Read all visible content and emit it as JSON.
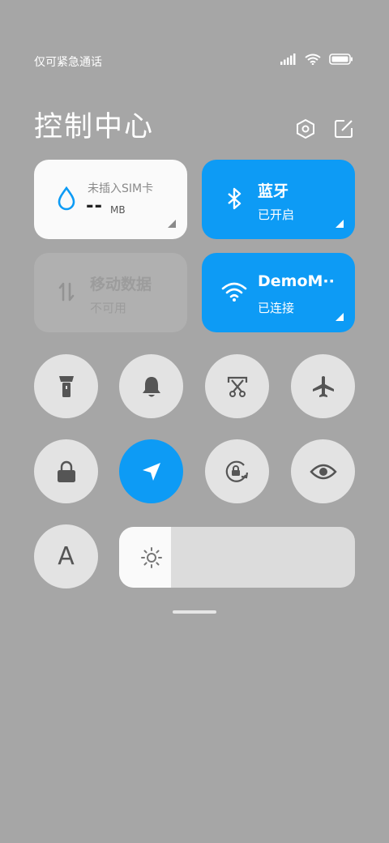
{
  "status_bar": {
    "carrier": "仅可紧急通话"
  },
  "header": {
    "title": "控制中心"
  },
  "tiles": {
    "data": {
      "label": "未插入SIM卡",
      "value": "--",
      "unit": "MB"
    },
    "bluetooth": {
      "label": "蓝牙",
      "status": "已开启"
    },
    "mobile": {
      "label": "移动数据",
      "status": "不可用"
    },
    "wifi": {
      "label": "DemoM··",
      "status": "已连接"
    }
  },
  "toggles": [
    {
      "icon": "flashlight-icon",
      "active": false
    },
    {
      "icon": "bell-icon",
      "active": false
    },
    {
      "icon": "screenshot-icon",
      "active": false
    },
    {
      "icon": "airplane-icon",
      "active": false
    },
    {
      "icon": "lock-icon",
      "active": false
    },
    {
      "icon": "location-icon",
      "active": true
    },
    {
      "icon": "rotation-lock-icon",
      "active": false
    },
    {
      "icon": "eye-icon",
      "active": false
    },
    {
      "icon": "font-icon",
      "active": false,
      "label": "A"
    }
  ],
  "brightness": {
    "level": 0.22
  },
  "colors": {
    "accent": "#0d9bf5",
    "background": "#a6a6a6",
    "button": "#e3e3e3"
  }
}
